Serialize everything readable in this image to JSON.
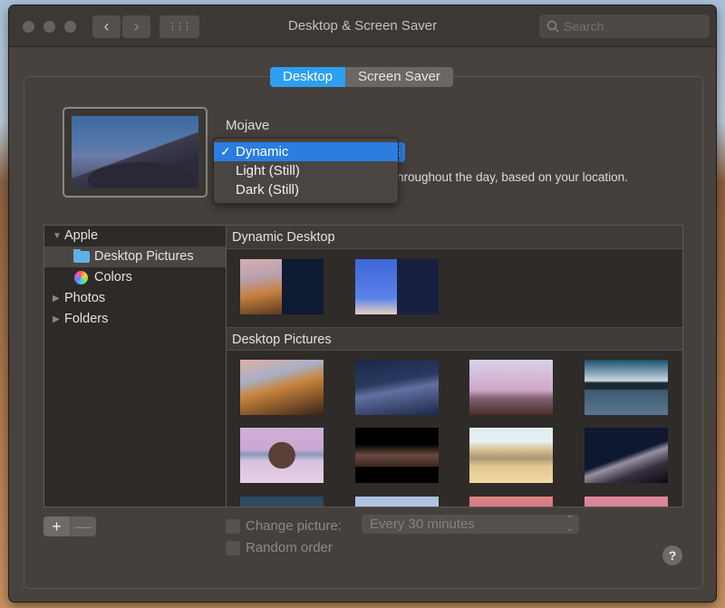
{
  "window": {
    "title": "Desktop & Screen Saver",
    "search_placeholder": "Search",
    "back_label": "‹",
    "forward_label": "›",
    "grid_icon": "⋮⋮⋮"
  },
  "tabs": [
    {
      "label": "Desktop",
      "active": true
    },
    {
      "label": "Screen Saver",
      "active": false
    }
  ],
  "wallpaper": {
    "name": "Mojave",
    "description_visible": "hroughout the day, based on your location.",
    "mode_menu": [
      {
        "label": "Dynamic",
        "selected": true,
        "check": "✓"
      },
      {
        "label": "Light (Still)",
        "selected": false
      },
      {
        "label": "Dark (Still)",
        "selected": false
      }
    ]
  },
  "sidebar": {
    "items": [
      {
        "label": "Apple",
        "disclosure": "▼",
        "expanded": true
      },
      {
        "label": "Desktop Pictures",
        "icon": "folder-icon",
        "selected": true
      },
      {
        "label": "Colors",
        "icon": "color-wheel-icon"
      },
      {
        "label": "Photos",
        "disclosure": "▶"
      },
      {
        "label": "Folders",
        "disclosure": "▶"
      }
    ]
  },
  "content": {
    "sections": [
      {
        "title": "Dynamic Desktop",
        "thumb_count": 2
      },
      {
        "title": "Desktop Pictures",
        "thumb_count": 12
      }
    ]
  },
  "bottom": {
    "add_label": "+",
    "remove_label": "—",
    "change_picture_label": "Change picture:",
    "change_picture_checked": false,
    "random_order_label": "Random order",
    "random_order_checked": false,
    "interval_value": "Every 30 minutes",
    "help_label": "?"
  },
  "colors": {
    "accent": "#2d9ff2",
    "menu_highlight": "#2b7de0",
    "window_bg": "#47423e"
  }
}
